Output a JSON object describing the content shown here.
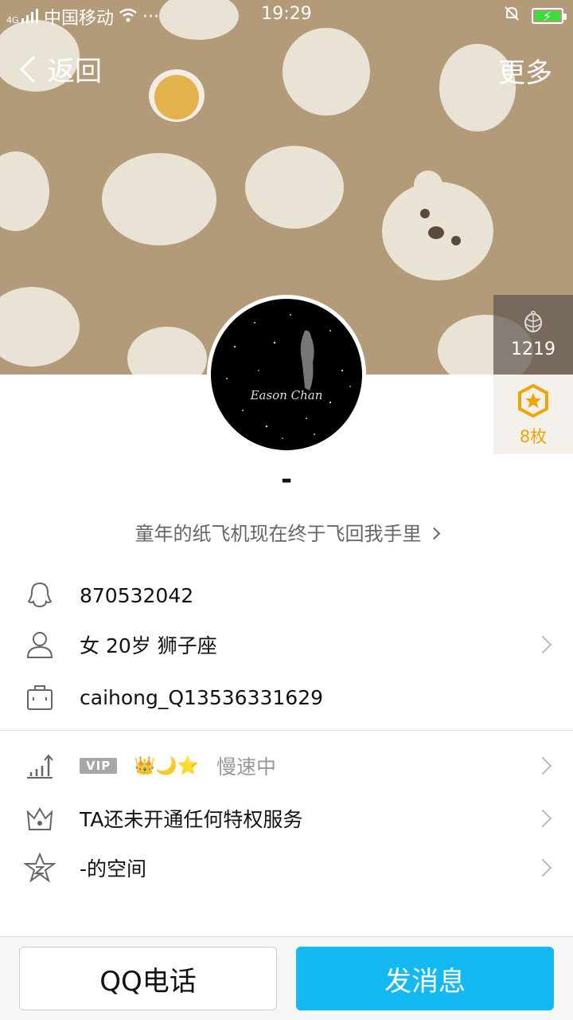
{
  "status_bar": {
    "signal": "4G",
    "carrier": "中国移动",
    "dots": "···",
    "time": "19:29"
  },
  "nav": {
    "back_label": "返回",
    "more_label": "更多"
  },
  "side_badges": {
    "like_count": "1219",
    "medal_count": "8枚"
  },
  "avatar": {
    "signature_text": "Eason Chan"
  },
  "profile": {
    "nickname": "-",
    "motto": "童年的纸飞机现在终于飞回我手里"
  },
  "info": {
    "qq_number": "870532042",
    "personal": "女  20岁  狮子座",
    "account": "caihong_Q13536331629"
  },
  "vip": {
    "tag": "VIP",
    "icons": "👑🌙⭐",
    "state": "慢速中"
  },
  "privilege": {
    "text": "TA还未开通任何特权服务"
  },
  "space": {
    "text": "-的空间"
  },
  "actions": {
    "call_label": "QQ电话",
    "message_label": "发消息"
  },
  "colors": {
    "cover_bg": "#b39b79",
    "accent_blue": "#15b9f2",
    "medal_gold": "#f0a500"
  }
}
